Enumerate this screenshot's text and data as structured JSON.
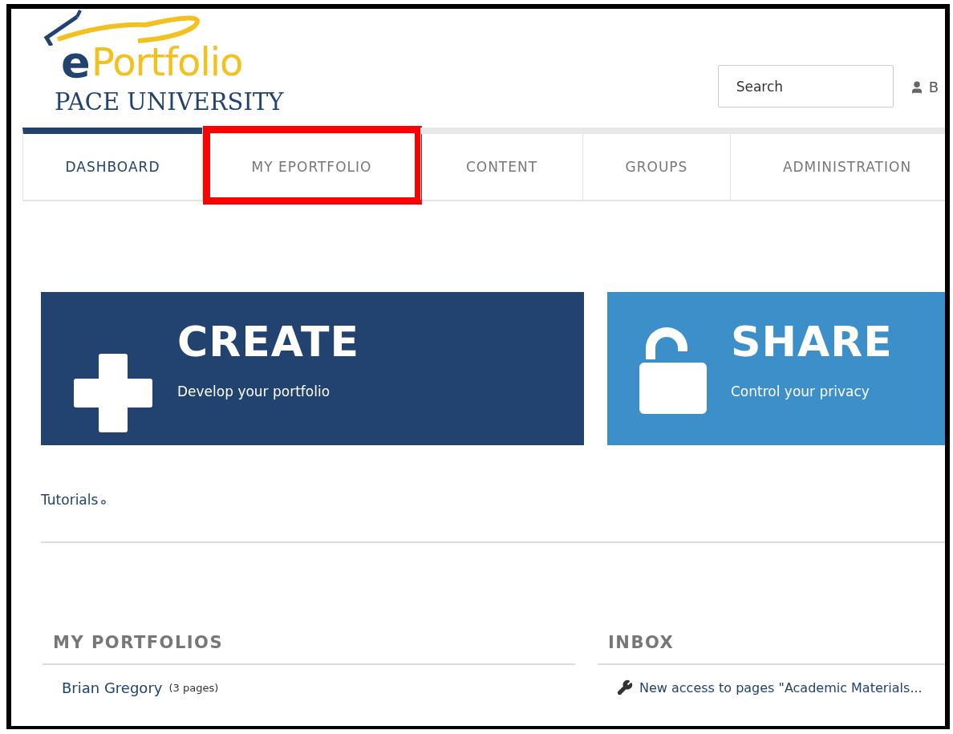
{
  "logo": {
    "letter": "e",
    "word": "Portfolio",
    "institution": "PACE UNIVERSITY"
  },
  "search": {
    "placeholder": "Search"
  },
  "user": {
    "name": "B"
  },
  "tabs": [
    {
      "label": "DASHBOARD",
      "selected": true,
      "highlighted": false
    },
    {
      "label": "MY EPORTFOLIO",
      "selected": false,
      "highlighted": true
    },
    {
      "label": "CONTENT",
      "selected": false,
      "highlighted": false
    },
    {
      "label": "GROUPS",
      "selected": false,
      "highlighted": false
    },
    {
      "label": "ADMINISTRATION",
      "selected": false,
      "highlighted": false
    }
  ],
  "cards": [
    {
      "kind": "create",
      "title": "CREATE",
      "subtitle": "Develop your portfolio",
      "color": "#22426f"
    },
    {
      "kind": "share",
      "title": "SHARE",
      "subtitle": "Control your privacy",
      "color": "#3d8fc9"
    }
  ],
  "tutorials_link": "Tutorials",
  "sections": [
    {
      "heading": "MY PORTFOLIOS",
      "items": [
        {
          "kind": "portfolio",
          "title": "Brian Gregory",
          "note": "(3 pages)"
        }
      ]
    },
    {
      "heading": "INBOX",
      "items": [
        {
          "kind": "message",
          "title": "New access to pages \"Academic Materials..."
        }
      ]
    }
  ]
}
